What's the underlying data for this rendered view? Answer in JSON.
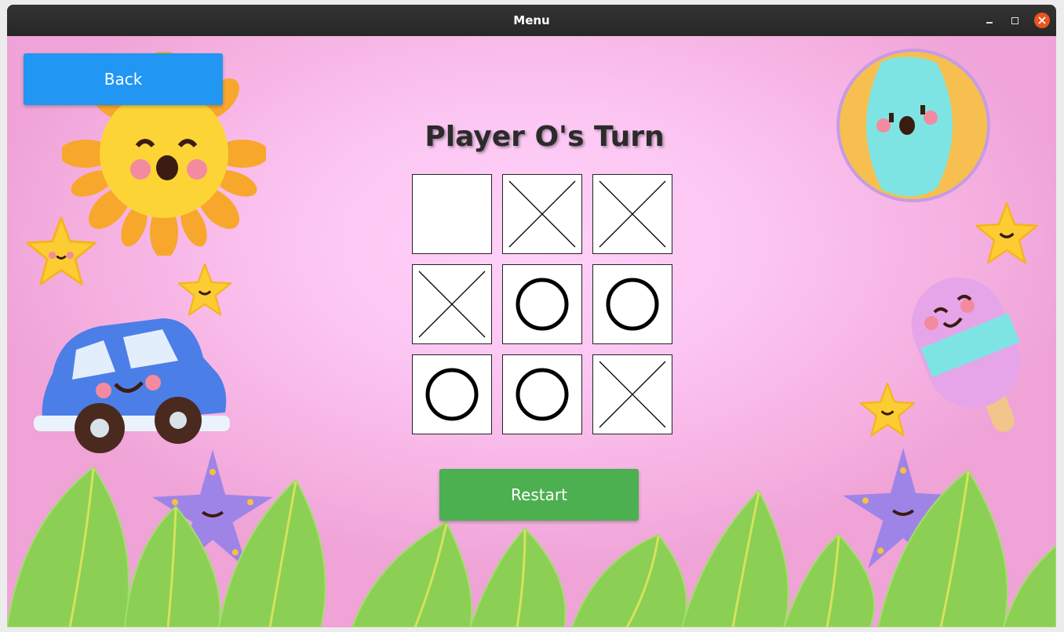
{
  "window": {
    "title": "Menu",
    "controls": {
      "minimize": "minimize-icon",
      "maximize": "maximize-icon",
      "close": "close-icon"
    },
    "close_color": "#e95420"
  },
  "game": {
    "status": "Player O's Turn",
    "board": [
      "",
      "X",
      "X",
      "X",
      "O",
      "O",
      "O",
      "O",
      "X"
    ]
  },
  "buttons": {
    "back_label": "Back",
    "restart_label": "Restart"
  },
  "colors": {
    "back": "#2196f3",
    "restart": "#4caf50",
    "background": "#fcc6f3"
  },
  "decorations": [
    "sun",
    "beach-ball",
    "star",
    "car",
    "popsicle",
    "starfish",
    "leaves"
  ]
}
